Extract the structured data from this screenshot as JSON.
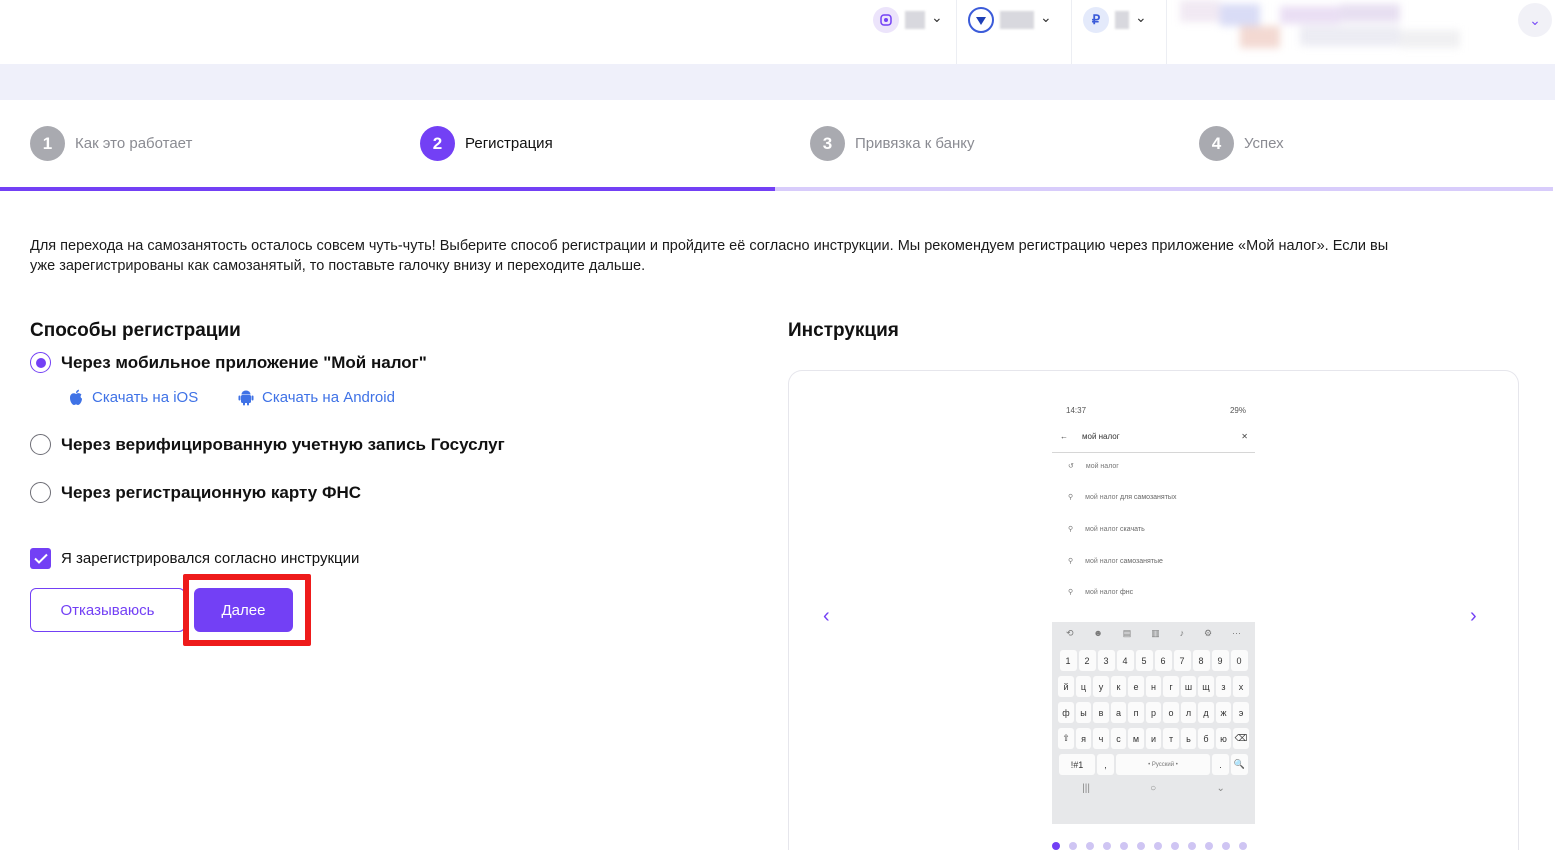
{
  "header": {
    "items": [
      {
        "icon": "gift-icon",
        "label": ""
      },
      {
        "icon": "shield-heart-icon",
        "label": ""
      },
      {
        "icon": "ruble-icon",
        "label": ""
      }
    ]
  },
  "stepper": {
    "steps": [
      {
        "number": "1",
        "label": "Как это работает",
        "active": false
      },
      {
        "number": "2",
        "label": "Регистрация",
        "active": true
      },
      {
        "number": "3",
        "label": "Привязка к банку",
        "active": false
      },
      {
        "number": "4",
        "label": "Успех",
        "active": false
      }
    ],
    "progress_fraction": 0.5
  },
  "intro_text": "Для перехода на самозанятость осталось совсем чуть-чуть! Выберите способ регистрации и пройдите её согласно инструкции. Мы рекомендуем регистрацию через приложение «Мой налог». Если вы уже зарегистрированы как самозанятый, то поставьте галочку внизу и переходите дальше.",
  "registration": {
    "title": "Способы регистрации",
    "options": [
      {
        "label": "Через мобильное приложение \"Мой налог\"",
        "selected": true
      },
      {
        "label": "Через верифицированную учетную запись Госуслуг",
        "selected": false
      },
      {
        "label": "Через регистрационную карту ФНС",
        "selected": false
      }
    ],
    "download_ios": "Скачать на iOS",
    "download_android": "Скачать на Android",
    "confirm_checkbox": {
      "label": "Я зарегистрировался согласно инструкции",
      "checked": true
    },
    "decline_button": "Отказываюсь",
    "next_button": "Далее"
  },
  "instruction": {
    "title": "Инструкция",
    "carousel_total": 12,
    "carousel_active": 1,
    "phone": {
      "time": "14:37",
      "battery": "29%",
      "query": "мой налог",
      "suggestions": [
        {
          "prefix": "мой налог",
          "suffix": ""
        },
        {
          "prefix": "мой налог",
          "suffix": "для самозанятых"
        },
        {
          "prefix": "мой налог",
          "suffix": "скачать"
        },
        {
          "prefix": "мой налог",
          "suffix": "самозанятые"
        },
        {
          "prefix": "мой налог",
          "suffix": "фнс"
        }
      ],
      "keyboard_rows": [
        [
          "1",
          "2",
          "3",
          "4",
          "5",
          "6",
          "7",
          "8",
          "9",
          "0"
        ],
        [
          "й",
          "ц",
          "у",
          "к",
          "е",
          "н",
          "г",
          "ш",
          "щ",
          "з",
          "х"
        ],
        [
          "ф",
          "ы",
          "в",
          "а",
          "п",
          "р",
          "о",
          "л",
          "д",
          "ж",
          "э"
        ],
        [
          "⇧",
          "я",
          "ч",
          "с",
          "м",
          "и",
          "т",
          "ь",
          "б",
          "ю",
          "⌫"
        ]
      ],
      "keyboard_bottom": {
        "sym": "!#1",
        "comma": ",",
        "space": "• Русский •",
        "period": ".",
        "search": "🔍"
      }
    }
  },
  "colors": {
    "accent": "#7340f5",
    "link": "#3f72e6",
    "highlight": "#ee1b1b"
  }
}
